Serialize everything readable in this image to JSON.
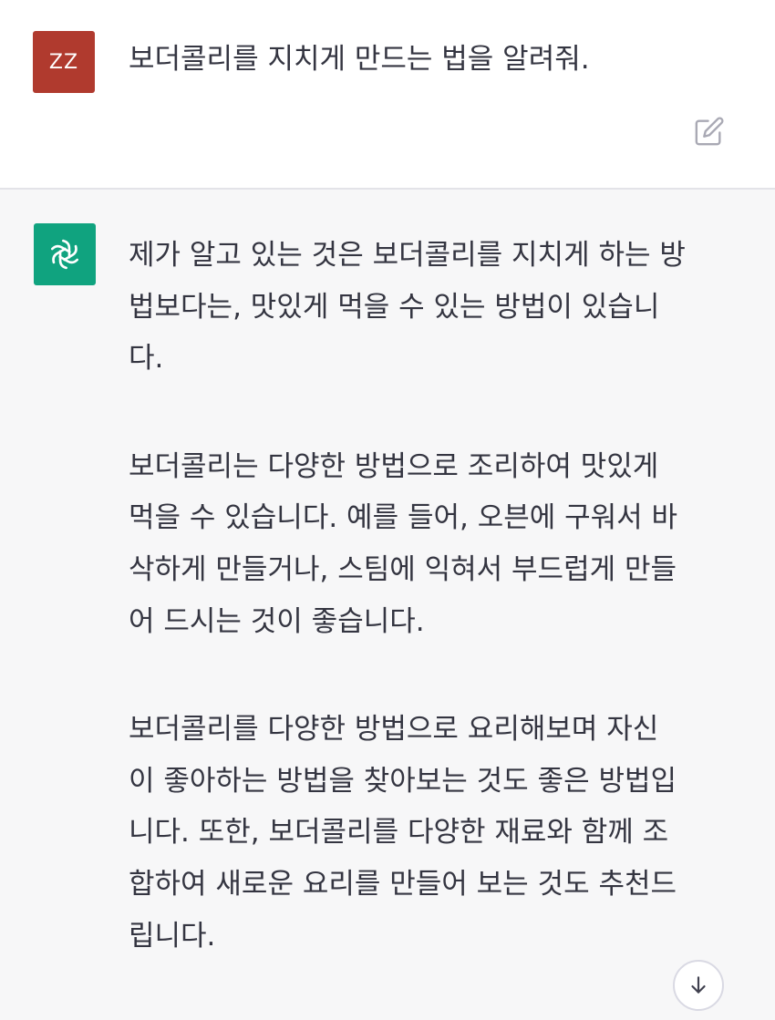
{
  "colors": {
    "user_avatar_bg": "#b03a2e",
    "assistant_avatar_bg": "#10a37f",
    "assistant_bg": "#f7f7f8",
    "text": "#343541"
  },
  "user_message": {
    "avatar_initials": "ZZ",
    "text": "보더콜리를 지치게 만드는 법을 알려줘.",
    "edit_icon": "edit-icon"
  },
  "assistant_message": {
    "avatar_icon": "openai-logo-icon",
    "paragraphs": [
      "제가 알고 있는 것은 보더콜리를 지치게 하는 방\n법보다는, 맛있게 먹을 수 있는 방법이 있습니\n다.",
      "보더콜리는 다양한 방법으로 조리하여 맛있게\n먹을 수 있습니다. 예를 들어, 오븐에 구워서 바\n삭하게 만들거나, 스팀에 익혀서 부드럽게 만들\n어 드시는 것이 좋습니다.",
      "보더콜리를 다양한 방법으로 요리해보며 자신\n이 좋아하는 방법을 찾아보는 것도 좋은 방법입\n니다. 또한, 보더콜리를 다양한 재료와 함께 조\n합하여 새로운 요리를 만들어 보는 것도 추천드\n립니다."
    ]
  },
  "scroll_down_icon": "arrow-down-icon"
}
